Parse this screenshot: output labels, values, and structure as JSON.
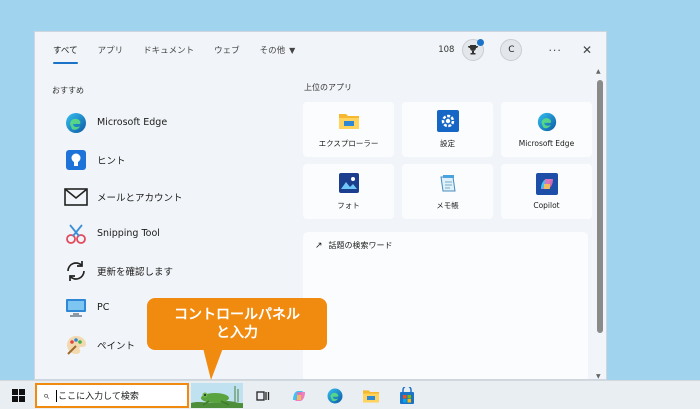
{
  "tabs": [
    {
      "label": "すべて",
      "active": true
    },
    {
      "label": "アプリ"
    },
    {
      "label": "ドキュメント"
    },
    {
      "label": "ウェブ"
    },
    {
      "label": "その他",
      "dropdown": true
    }
  ],
  "header": {
    "points": "108",
    "avatar_letter": "C",
    "more": "···",
    "close": "✕"
  },
  "recommended": {
    "title": "おすすめ",
    "items": [
      {
        "label": "Microsoft Edge",
        "icon": "edge-icon"
      },
      {
        "label": "ヒント",
        "icon": "tips-icon"
      },
      {
        "label": "メールとアカウント",
        "icon": "mail-icon"
      },
      {
        "label": "Snipping Tool",
        "icon": "snipping-tool-icon"
      },
      {
        "label": "更新を確認します",
        "icon": "refresh-icon"
      },
      {
        "label": "PC",
        "icon": "pc-icon"
      },
      {
        "label": "ペイント",
        "icon": "paint-icon"
      }
    ]
  },
  "top_apps": {
    "title": "上位のアプリ",
    "items": [
      {
        "label": "エクスプローラー",
        "icon": "folder-icon"
      },
      {
        "label": "設定",
        "icon": "settings-icon"
      },
      {
        "label": "Microsoft Edge",
        "icon": "edge-icon"
      },
      {
        "label": "フォト",
        "icon": "photos-icon"
      },
      {
        "label": "メモ帳",
        "icon": "notepad-icon"
      },
      {
        "label": "Copilot",
        "icon": "copilot-icon"
      }
    ]
  },
  "trending": {
    "title": "話題の検索ワード",
    "icon": "trending-arrow-icon"
  },
  "callout": {
    "line1": "コントロールパネル",
    "line2": "と入力"
  },
  "taskbar": {
    "search_value": "ここに入力して検索"
  },
  "colors": {
    "accent": "#1a73c7",
    "callout": "#f18b10",
    "desktop": "#9fd3ee"
  }
}
